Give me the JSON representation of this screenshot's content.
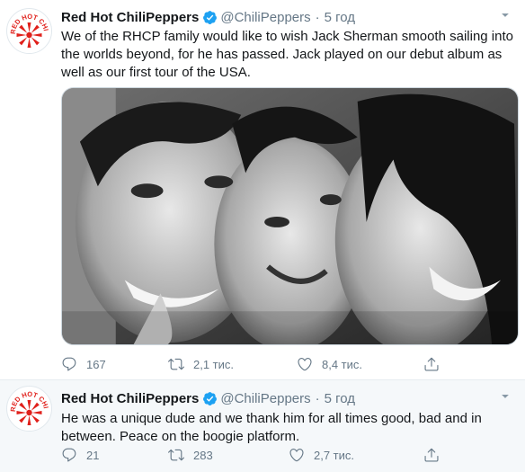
{
  "tweets": [
    {
      "author_name": "Red Hot ChiliPeppers",
      "handle": "@ChiliPeppers",
      "separator": "·",
      "time": "5 год",
      "text": "We of the RHCP family would like to wish Jack Sherman smooth sailing into the worlds beyond, for he has passed. Jack played on our debut album as well as our first tour of the USA.",
      "replies": "167",
      "retweets": "2,1 тис.",
      "likes": "8,4 тис."
    },
    {
      "author_name": "Red Hot ChiliPeppers",
      "handle": "@ChiliPeppers",
      "separator": "·",
      "time": "5 год",
      "text": "He was a unique dude and we thank him for all times good, bad and in between. Peace on the boogie platform.",
      "replies": "21",
      "retweets": "283",
      "likes": "2,7 тис."
    }
  ],
  "avatar_logo_text": "RED HOT CHILI PEPPERS",
  "colors": {
    "accent": "#1da1f2",
    "secondary_text": "#657786",
    "logo_red": "#e0201b"
  },
  "icons": [
    "verified-badge-icon",
    "chevron-down-icon",
    "reply-icon",
    "retweet-icon",
    "like-icon",
    "share-icon"
  ]
}
